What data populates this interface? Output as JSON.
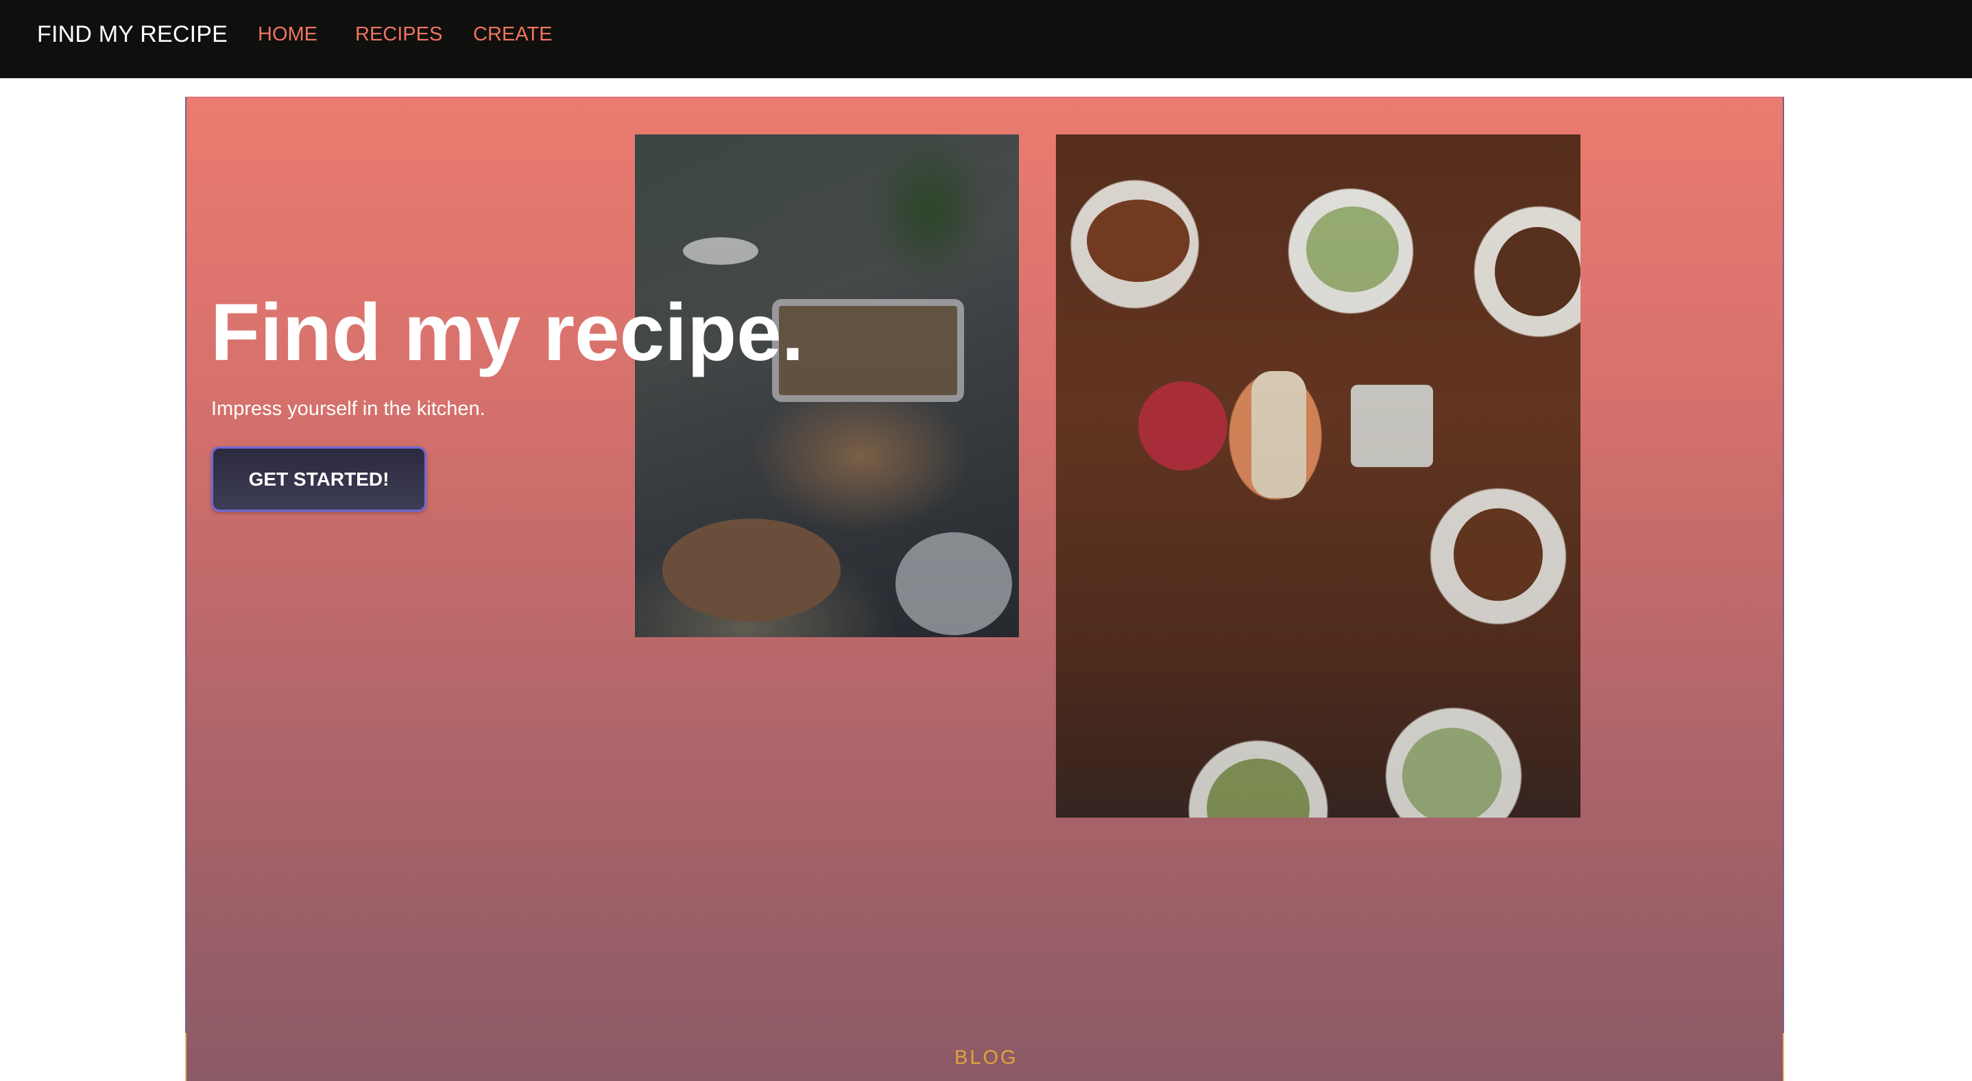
{
  "navbar": {
    "brand": "FIND MY RECIPE",
    "links": [
      {
        "label": "HOME"
      },
      {
        "label": "RECIPES"
      },
      {
        "label": "CREATE"
      }
    ],
    "background_color": "#0f0f0e",
    "link_color": "#f0745f"
  },
  "hero": {
    "title": "Find my recipe.",
    "subtitle": "Impress yourself in the kitchen.",
    "cta_label": "GET STARTED!",
    "gradient_top": "#eb7b70",
    "gradient_bottom": "#8a5a66",
    "images": [
      {
        "icon": "dinner-table-photo"
      },
      {
        "icon": "food-plates-overhead-photo"
      }
    ]
  },
  "footer": {
    "blog_label": "BLOG",
    "blog_color": "#e2a23c"
  }
}
